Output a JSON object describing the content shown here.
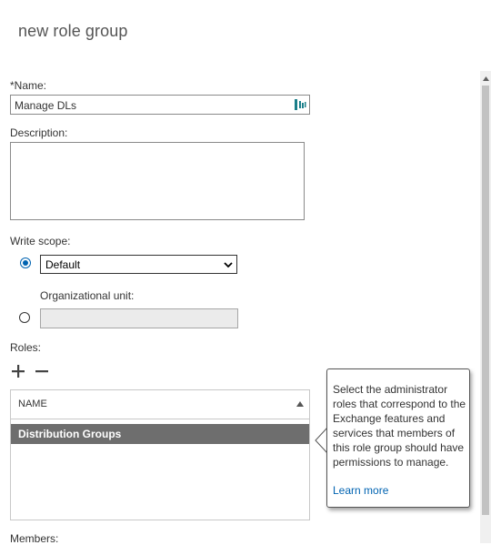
{
  "page": {
    "title": "new role group"
  },
  "name_field": {
    "label": "*Name:",
    "value": "Manage DLs"
  },
  "description": {
    "label": "Description:",
    "value": ""
  },
  "write_scope": {
    "label": "Write scope:",
    "selected": "Default",
    "organizational_unit_label": "Organizational unit:",
    "organizational_unit_value": ""
  },
  "roles": {
    "label": "Roles:",
    "column_header": "NAME",
    "rows": [
      "Distribution Groups"
    ]
  },
  "callout": {
    "text": "Select the administrator roles that correspond to the Exchange features and services that members of this role group should have permissions to manage.",
    "link": "Learn more"
  },
  "members": {
    "label": "Members:"
  },
  "colors": {
    "accent": "#0063b1",
    "selected_row": "#6e6e6e"
  }
}
